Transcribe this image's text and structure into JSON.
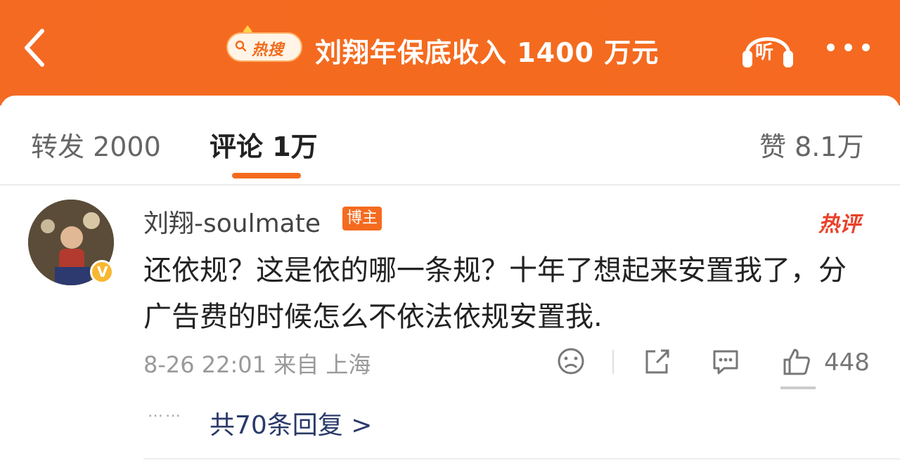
{
  "header": {
    "hot_badge_label": "热搜",
    "title": "刘翔年保底收入 1400 万元",
    "listen_label": "听",
    "accent_color": "#f46b1f"
  },
  "tabs": [
    {
      "label": "转发 2000",
      "active": false
    },
    {
      "label": "评论 1万",
      "active": true
    },
    {
      "label": "赞 8.1万",
      "active": false
    }
  ],
  "comment": {
    "username": "刘翔-soulmate",
    "author_tag": "博主",
    "hot_label": "热评",
    "text": "还依规？这是依的哪一条规？十年了想起来安置我了，分广告费的时候怎么不依法依规安置我.",
    "meta": "8-26 22:01 来自 上海",
    "like_count": "448",
    "replies_label": "共70条回复 >",
    "replies_dots": "……"
  },
  "icons": [
    "back-icon",
    "search-icon",
    "headphone-icon",
    "more-icon",
    "dislike-icon",
    "share-icon",
    "comment-icon",
    "like-icon",
    "verified-icon"
  ]
}
